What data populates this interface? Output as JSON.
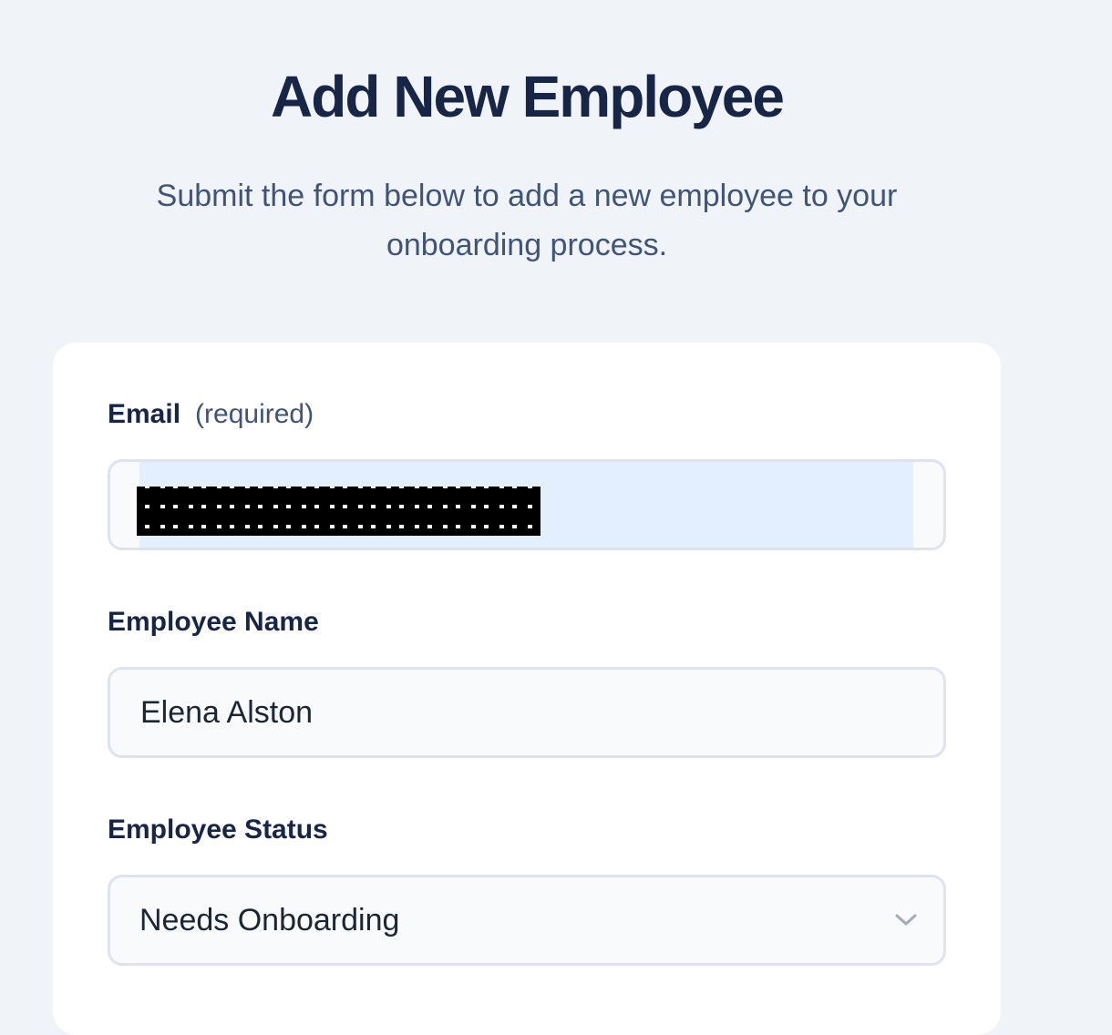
{
  "header": {
    "title": "Add New Employee",
    "subtitle": "Submit the form below to add a new employee to your onboarding process."
  },
  "form": {
    "email": {
      "label": "Email",
      "note": "(required)",
      "value": ""
    },
    "name": {
      "label": "Employee Name",
      "value": "Elena Alston"
    },
    "status": {
      "label": "Employee Status",
      "value": "Needs Onboarding",
      "icon": "chevron-down-icon"
    }
  },
  "colors": {
    "background": "#f0f4f9",
    "title": "#172647",
    "subtitle": "#3f5478",
    "autofill": "#e3efff"
  }
}
